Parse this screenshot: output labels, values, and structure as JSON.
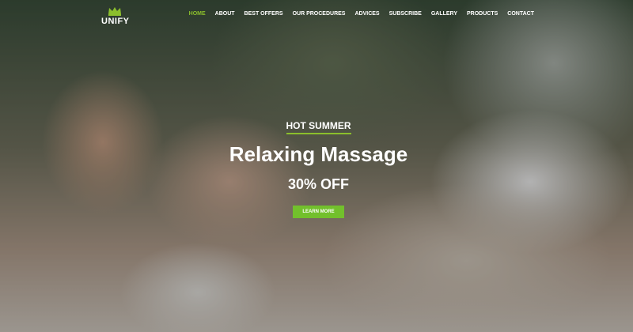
{
  "brand": {
    "name": "UNIFY",
    "icon": "crown-icon",
    "accent_color": "#8bbf2c"
  },
  "nav": {
    "items": [
      {
        "label": "HOME",
        "active": true
      },
      {
        "label": "ABOUT"
      },
      {
        "label": "BEST OFFERS"
      },
      {
        "label": "OUR PROCEDURES"
      },
      {
        "label": "ADVICES"
      },
      {
        "label": "SUBSCRIBE"
      },
      {
        "label": "GALLERY"
      },
      {
        "label": "PRODUCTS"
      },
      {
        "label": "CONTACT"
      }
    ]
  },
  "hero": {
    "kicker": "HOT SUMMER",
    "headline": "Relaxing Massage",
    "discount": "30% OFF",
    "cta_label": "LEARN MORE",
    "cta_color": "#72c02c"
  }
}
